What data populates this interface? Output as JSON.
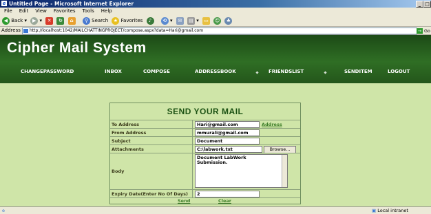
{
  "window": {
    "title": "Untitled Page - Microsoft Internet Explorer"
  },
  "menu": [
    "File",
    "Edit",
    "View",
    "Favorites",
    "Tools",
    "Help"
  ],
  "toolbar": {
    "back": "Back",
    "search": "Search",
    "favorites": "Favorites"
  },
  "address": {
    "label": "Address",
    "url": "http://localhost:1042/MAILCHATTINGPROJECT/compose.aspx?data=Hari@gmail.com",
    "go": "Go"
  },
  "site": {
    "logo": "Cipher Mail System"
  },
  "nav": [
    "CHANGEPASSWORD",
    "INBOX",
    "COMPOSE",
    "ADDRESSBOOK",
    "FRIENDSLIST",
    "SENDITEM",
    "LOGOUT"
  ],
  "form": {
    "title": "SEND YOUR MAIL",
    "to_label": "To Address",
    "to_value": "Hari@gmail.com",
    "address_link": "Address",
    "from_label": "From Address",
    "from_value": "mmurali@gmail.com",
    "subject_label": "Subject",
    "subject_value": "Document",
    "attach_label": "Attachments",
    "attach_value": "C:\\labwork.txt",
    "browse": "Browse...",
    "body_label": "Body",
    "body_value": "Document LabWork Submission.",
    "expiry_label": "Expiry Date(Enter No Of Days)",
    "expiry_value": "2",
    "send": "Send",
    "clear": "Clear"
  },
  "status": {
    "zone": "Local intranet"
  }
}
